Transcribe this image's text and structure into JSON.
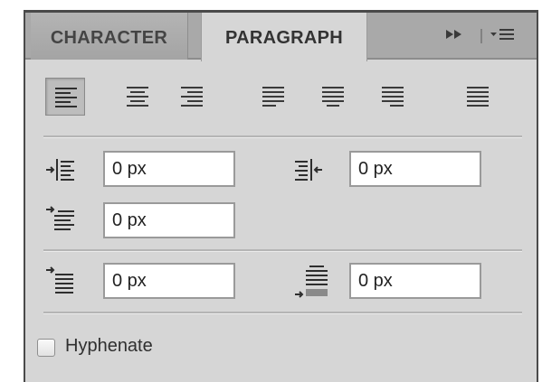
{
  "tabs": [
    {
      "label": "CHARACTER",
      "active": false
    },
    {
      "label": "PARAGRAPH",
      "active": true
    }
  ],
  "toolbar": {
    "collapse_icon": "double-arrow-right-icon",
    "menu_icon": "panel-menu-icon"
  },
  "alignment": {
    "buttons": [
      {
        "name": "align-left",
        "selected": true
      },
      {
        "name": "align-center",
        "selected": false
      },
      {
        "name": "align-right",
        "selected": false
      },
      {
        "name": "justify-last-left",
        "selected": false
      },
      {
        "name": "justify-last-center",
        "selected": false
      },
      {
        "name": "justify-last-right",
        "selected": false
      },
      {
        "name": "justify-all",
        "selected": false
      }
    ]
  },
  "fields": {
    "indent_left": "0 px",
    "indent_right": "0 px",
    "indent_first_line": "0 px",
    "space_before": "0 px",
    "space_after": "0 px"
  },
  "hyphenate": {
    "label": "Hyphenate",
    "checked": false
  },
  "colors": {
    "panel": "#d6d6d6",
    "tabbar": "#a9a9a9",
    "text": "#333333"
  }
}
